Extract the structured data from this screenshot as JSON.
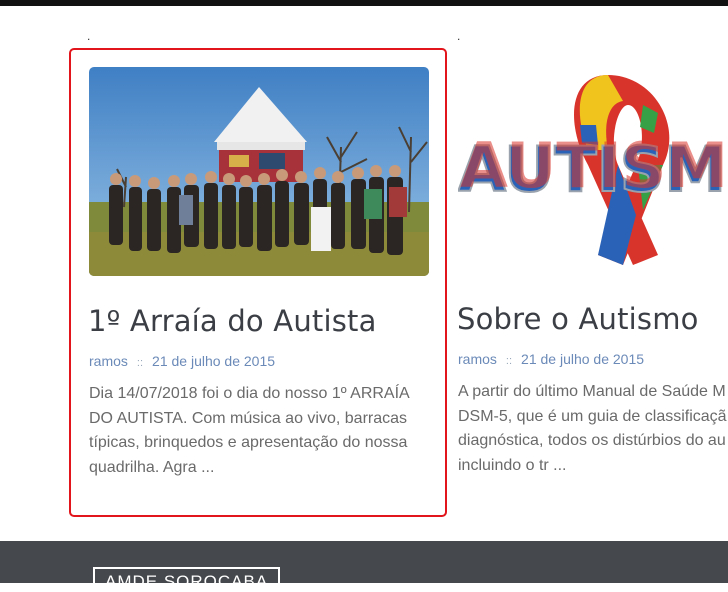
{
  "posts": [
    {
      "title": "1º Arraía do Autista",
      "author": "ramos",
      "separator": "::",
      "date": "21 de julho de 2015",
      "excerpt": "Dia 14/07/2018 foi o dia do nosso 1º ARRAÍA DO AUTISTA. Com música ao vivo, barracas típicas, brinquedos e apresentação do nossa quadrilha. Agra ...",
      "image": "group-photo"
    },
    {
      "title": "Sobre o Autismo",
      "author": "ramos",
      "separator": "::",
      "date": "21 de julho de 2015",
      "excerpt_lines": [
        "A partir do último Manual de Saúde M",
        "DSM-5, que é um guia de classificaçã",
        "diagnóstica, todos os distúrbios do au",
        "incluindo o tr ..."
      ],
      "image_text": "AUTISMO",
      "image": "autism-ribbon"
    }
  ],
  "footer": {
    "brand": "AMDE SOROCABA"
  },
  "colors": {
    "highlight": "#e1151b",
    "meta": "#6b8ab8",
    "footer_bg": "#45484c"
  }
}
